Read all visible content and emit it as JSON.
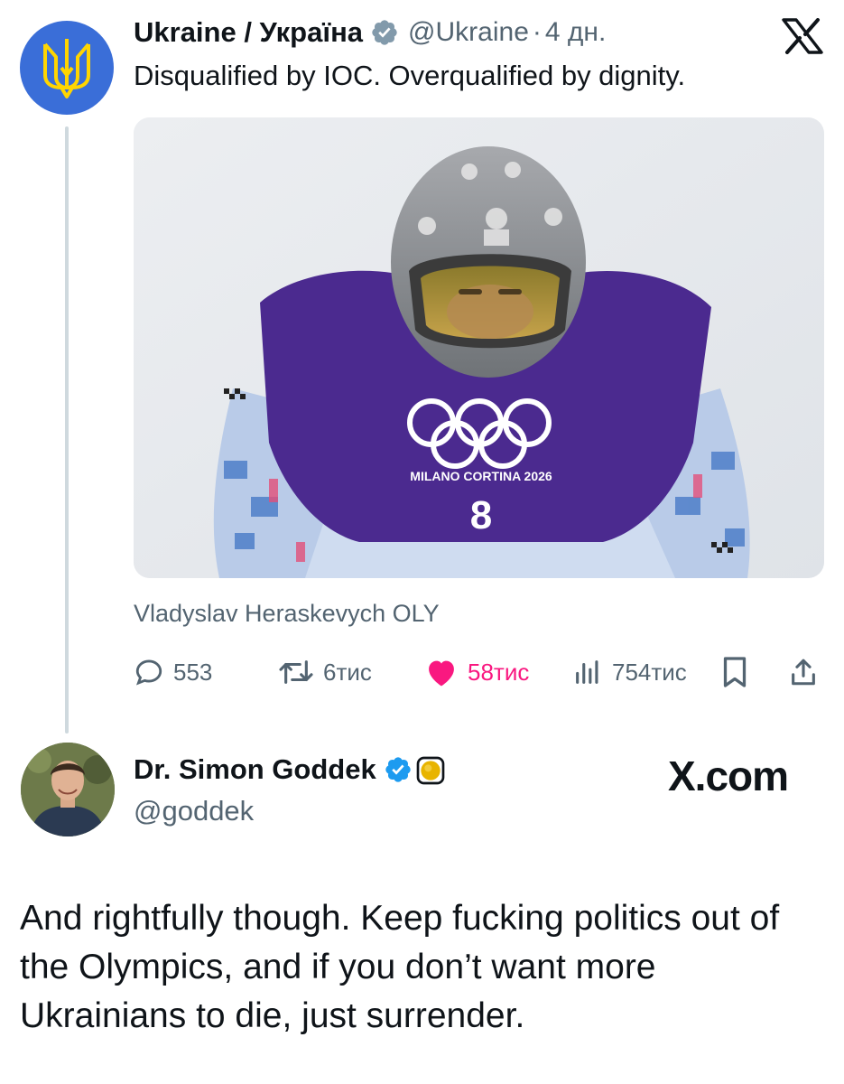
{
  "quoted_tweet": {
    "display_name": "Ukraine / Україна",
    "handle": "@Ukraine",
    "separator": "·",
    "time": "4 дн.",
    "text": "Disqualified by IOC. Overqualified by dignity.",
    "media_caption": "Vladyslav Heraskevych OLY",
    "media_text": {
      "games_label": "MILANO CORTINA 2026",
      "bib_number": "8"
    },
    "actions": {
      "replies": "553",
      "reposts": "6тис",
      "likes": "58тис",
      "views": "754тис"
    }
  },
  "reply_tweet": {
    "display_name": "Dr. Simon Goddek",
    "handle": "@goddek",
    "site_label": "X.com",
    "text": "And rightfully though. Keep fucking politics out of the Olympics, and if you don’t want more Ukrainians to die, just surrender."
  },
  "colors": {
    "verified_gray": "#829aab",
    "verified_blue": "#1d9bf0",
    "like_pink": "#f91880",
    "muted_text": "#536471",
    "ukraine_avatar_blue": "#3a6ed8",
    "trident_yellow": "#ffd500"
  },
  "icons": [
    "ukraine-trident-icon",
    "verified-badge-icon",
    "x-logo-icon",
    "reply-icon",
    "repost-icon",
    "heart-icon",
    "views-icon",
    "bookmark-icon",
    "share-icon",
    "gold-badge-icon"
  ]
}
